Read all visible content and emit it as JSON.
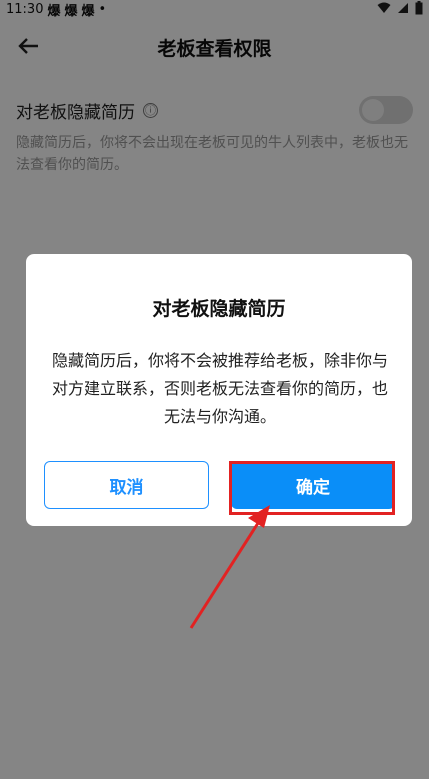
{
  "statusbar": {
    "time": "11:30",
    "apps": [
      "爆",
      "爆",
      "爆"
    ],
    "dot": "•"
  },
  "header": {
    "title": "老板查看权限"
  },
  "setting": {
    "label": "对老板隐藏简历",
    "info_icon": "ⓘ",
    "description": "隐藏简历后，你将不会出现在老板可见的牛人列表中，老板也无法查看你的简历。"
  },
  "dialog": {
    "title": "对老板隐藏简历",
    "body": "隐藏简历后，你将不会被推荐给老板，除非你与对方建立联系，否则老板无法查看你的简历，也无法与你沟通。",
    "cancel_label": "取消",
    "ok_label": "确定"
  },
  "colors": {
    "accent": "#0a8ef8",
    "highlight": "#e22222",
    "overlay": "rgba(0,0,0,0.48)"
  }
}
